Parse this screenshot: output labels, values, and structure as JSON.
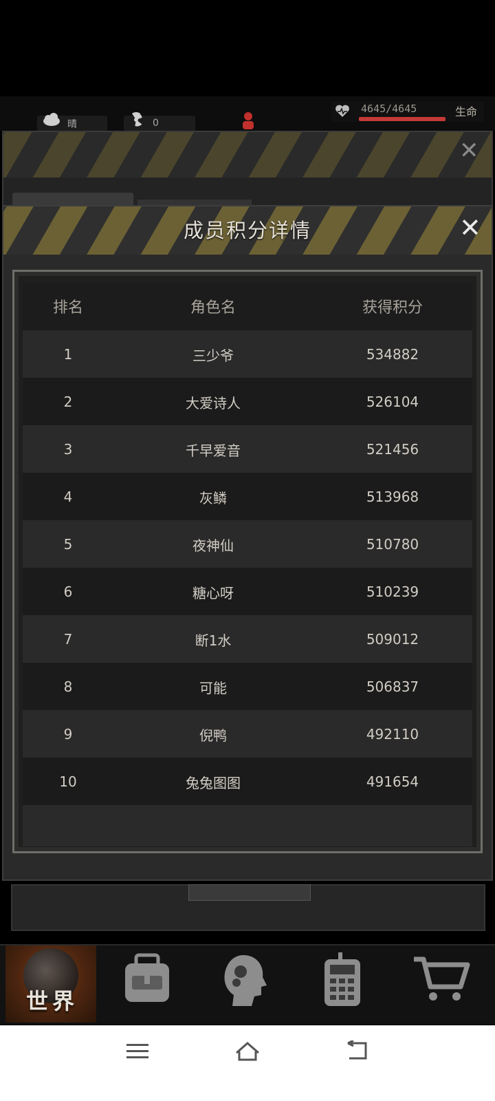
{
  "status": {
    "weather_label": "晴",
    "radiation_value": "0",
    "hp_text": "4645/4645",
    "hp_fraction": 1.0,
    "hp_label": "生命"
  },
  "dialog": {
    "title": "成员积分详情"
  },
  "table": {
    "headers": [
      "排名",
      "角色名",
      "获得积分"
    ],
    "rows": [
      {
        "rank": "1",
        "name": "三少爷",
        "score": "534882"
      },
      {
        "rank": "2",
        "name": "大爱诗人",
        "score": "526104"
      },
      {
        "rank": "3",
        "name": "千早爱音",
        "score": "521456"
      },
      {
        "rank": "4",
        "name": "灰鳞",
        "score": "513968"
      },
      {
        "rank": "5",
        "name": "夜神仙",
        "score": "510780"
      },
      {
        "rank": "6",
        "name": "糖心呀",
        "score": "510239"
      },
      {
        "rank": "7",
        "name": "断1水",
        "score": "509012"
      },
      {
        "rank": "8",
        "name": "可能",
        "score": "506837"
      },
      {
        "rank": "9",
        "name": "倪鸭",
        "score": "492110"
      },
      {
        "rank": "10",
        "name": "兔兔图图",
        "score": "491654"
      }
    ]
  },
  "bottom_nav": {
    "world_label": "世界",
    "items": [
      "world-icon",
      "backpack-icon",
      "skills-head-icon",
      "calculator-icon",
      "cart-icon"
    ]
  },
  "system_nav": {
    "icons": [
      "menu-icon",
      "home-icon",
      "back-icon"
    ]
  },
  "colors": {
    "hp_bar": "#c43a36",
    "hazard_yellow": "#6b6134",
    "panel": "#2a2a2a"
  }
}
